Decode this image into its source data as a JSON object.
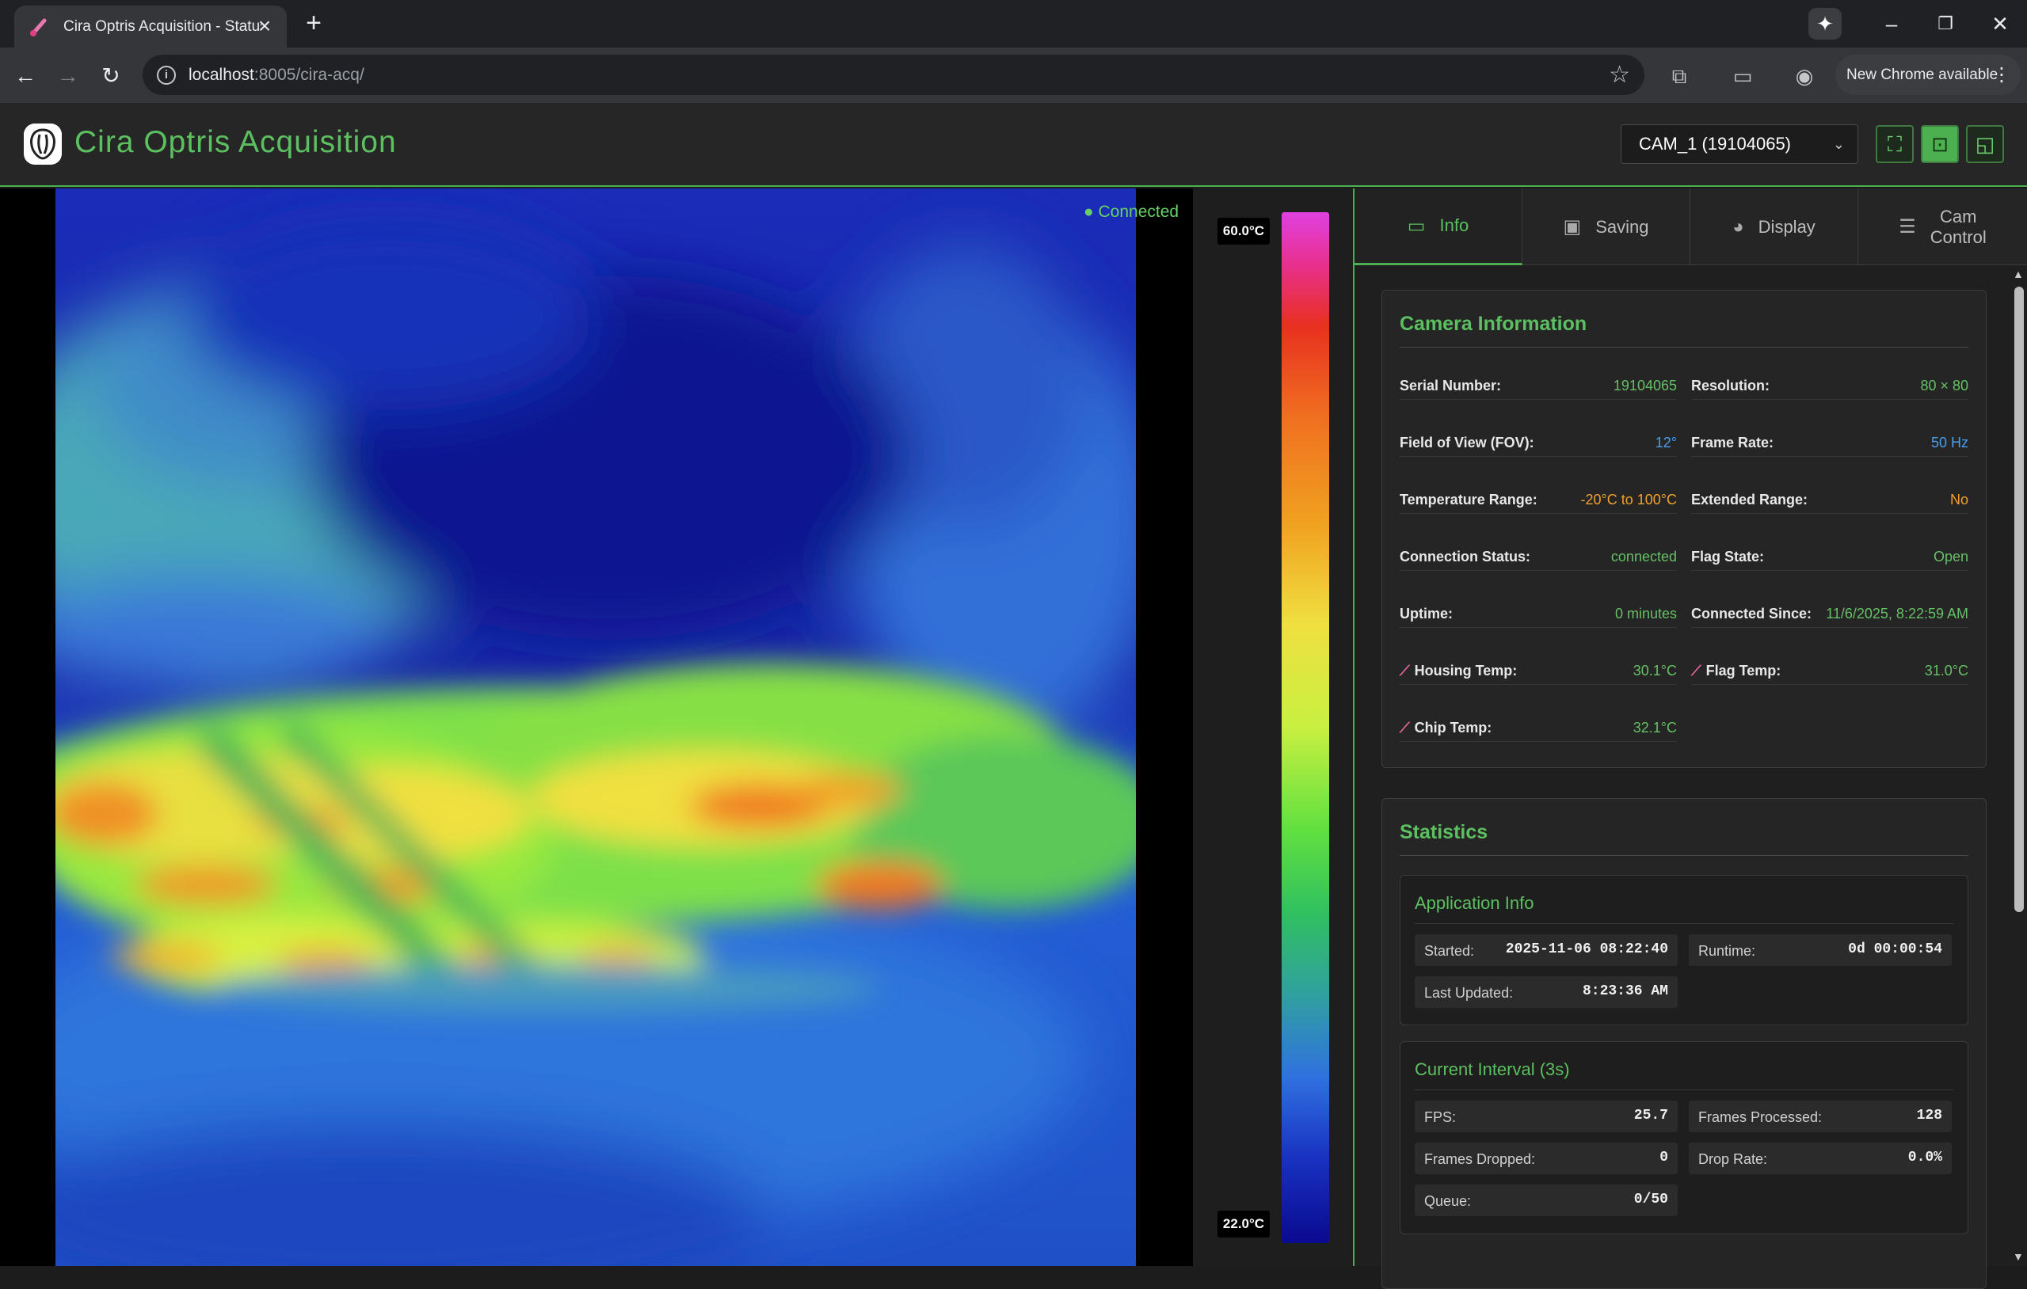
{
  "browser": {
    "tab_title": "Cira Optris Acquisition - Status",
    "url_host": "localhost",
    "url_rest": ":8005/cira-acq/",
    "update_label": "New Chrome available"
  },
  "app": {
    "title": "Cira Optris Acquisition",
    "camera_selected": "CAM_1 (19104065)"
  },
  "viewport": {
    "connection_status": "● Connected",
    "scale_max": "60.0°C",
    "scale_min": "22.0°C"
  },
  "tabs": [
    {
      "label": "Info",
      "icon": "monitor-icon"
    },
    {
      "label": "Saving",
      "icon": "save-icon"
    },
    {
      "label": "Display",
      "icon": "palette-icon"
    },
    {
      "label": "Cam Control",
      "line1": "Cam",
      "line2": "Control",
      "icon": "sliders-icon"
    }
  ],
  "camera_info": {
    "title": "Camera Information",
    "fields": [
      {
        "label": "Serial Number:",
        "value": "19104065"
      },
      {
        "label": "Resolution:",
        "value": "80 × 80"
      },
      {
        "label": "Field of View (FOV):",
        "value": "12°"
      },
      {
        "label": "Frame Rate:",
        "value": "50 Hz"
      },
      {
        "label": "Temperature Range:",
        "value": "-20°C to 100°C"
      },
      {
        "label": "Extended Range:",
        "value": "No"
      },
      {
        "label": "Connection Status:",
        "value": "connected"
      },
      {
        "label": "Flag State:",
        "value": "Open"
      },
      {
        "label": "Uptime:",
        "value": "0 minutes"
      },
      {
        "label": "Connected Since:",
        "value": "11/6/2025, 8:22:59 AM"
      },
      {
        "label": "Housing Temp:",
        "value": "30.1°C"
      },
      {
        "label": "Flag Temp:",
        "value": "31.0°C"
      },
      {
        "label": "Chip Temp:",
        "value": "32.1°C"
      }
    ]
  },
  "statistics": {
    "title": "Statistics",
    "app_info": {
      "title": "Application Info",
      "started_label": "Started:",
      "started": "2025-11-06 08:22:40",
      "runtime_label": "Runtime:",
      "runtime": "0d 00:00:54",
      "updated_label": "Last Updated:",
      "updated": "8:23:36 AM"
    },
    "interval": {
      "title": "Current Interval (3s)",
      "fps_label": "FPS:",
      "fps": "25.7",
      "processed_label": "Frames Processed:",
      "processed": "128",
      "dropped_label": "Frames Dropped:",
      "dropped": "0",
      "drop_rate_label": "Drop Rate:",
      "drop_rate": "0.0%",
      "queue_label": "Queue:",
      "queue": "0/50"
    }
  },
  "colors": {
    "accent": "#4caf50",
    "title_green": "#5cc060",
    "value_green": "#66c066",
    "value_blue": "#4a9ef0",
    "value_orange": "#f0a030"
  }
}
